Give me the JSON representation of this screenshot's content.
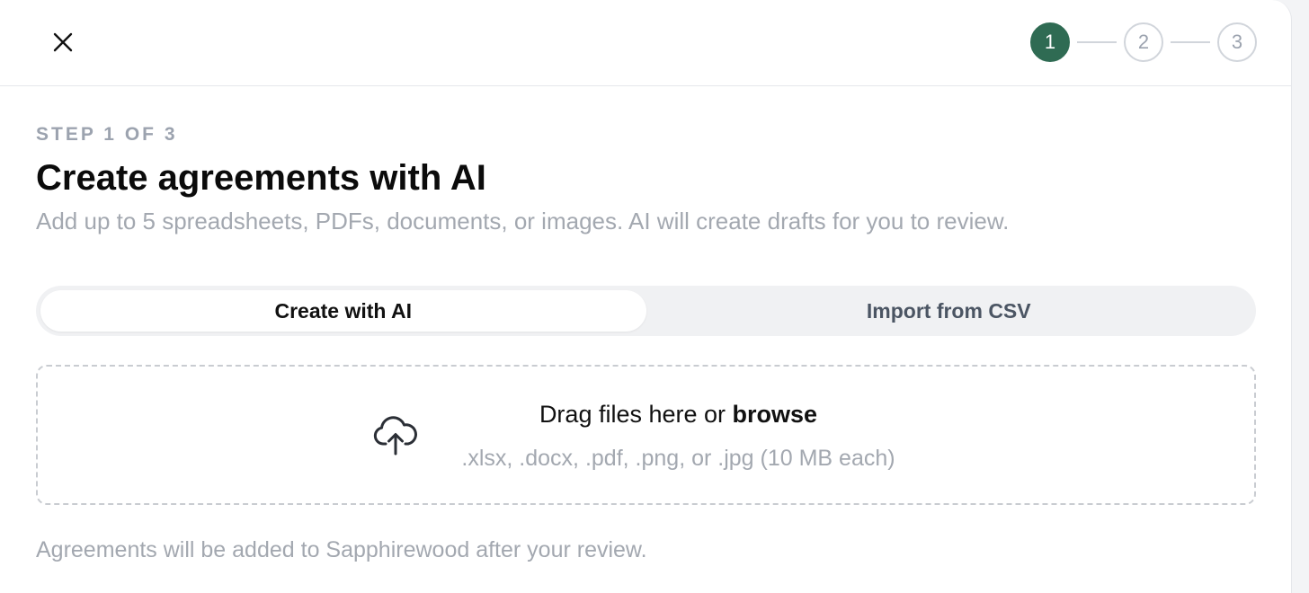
{
  "header": {
    "close_icon": "close-icon",
    "steps": [
      "1",
      "2",
      "3"
    ],
    "active_step": 1,
    "accent_color": "#2f6b53"
  },
  "main": {
    "eyebrow": "STEP 1 OF 3",
    "title": "Create agreements with AI",
    "subtitle": "Add up to 5 spreadsheets, PDFs, documents, or images. AI will create drafts for you to review.",
    "tabs": [
      {
        "label": "Create with AI",
        "selected": true
      },
      {
        "label": "Import from CSV",
        "selected": false
      }
    ],
    "dropzone": {
      "icon": "cloud-upload-icon",
      "prompt_text": "Drag files here or ",
      "browse_label": "browse",
      "hint": ".xlsx, .docx, .pdf, .png, or .jpg (10 MB each)"
    },
    "footnote": "Agreements will be added to Sapphirewood after your review."
  }
}
